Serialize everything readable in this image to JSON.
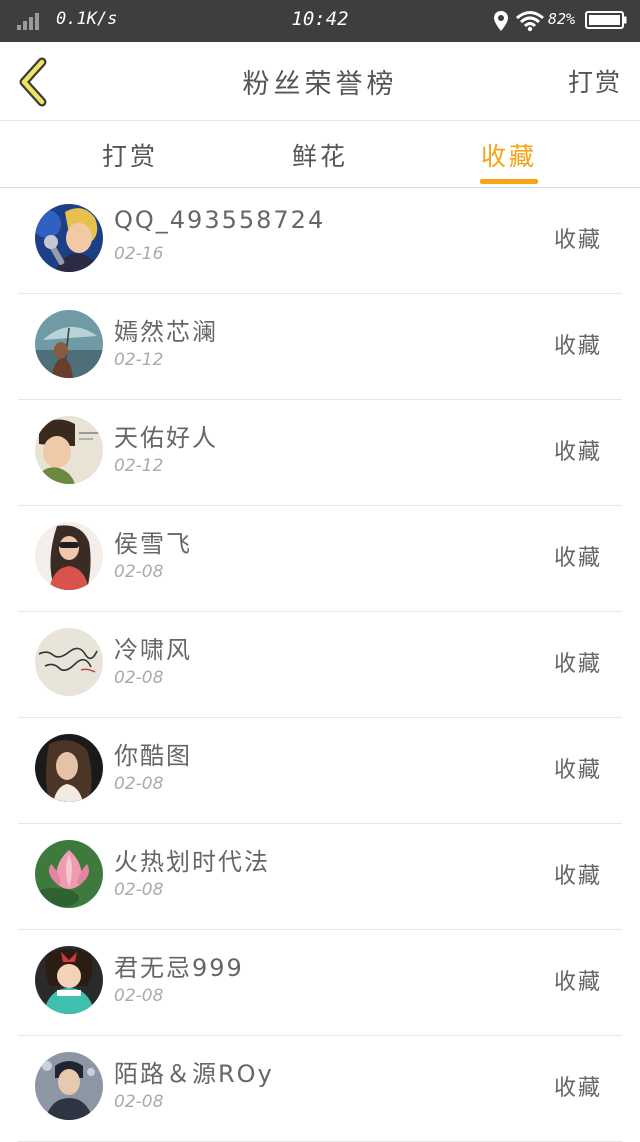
{
  "status_bar": {
    "speed": "0.1K/s",
    "time": "10:42",
    "battery": "82%"
  },
  "header": {
    "title": "粉丝荣誉榜",
    "action_label": "打赏"
  },
  "tabs": [
    {
      "label": "打赏",
      "active": false
    },
    {
      "label": "鲜花",
      "active": false
    },
    {
      "label": "收藏",
      "active": true
    }
  ],
  "accent_color": "#f5a417",
  "rows": [
    {
      "name": "QQ_493558724",
      "date": "02-16",
      "action": "收藏",
      "avatar": "avatar-singer-icon"
    },
    {
      "name": "嫣然芯澜",
      "date": "02-12",
      "action": "收藏",
      "avatar": "avatar-umbrella-girl-icon"
    },
    {
      "name": "天佑好人",
      "date": "02-12",
      "action": "收藏",
      "avatar": "avatar-boy-portrait-icon"
    },
    {
      "name": "侯雪飞",
      "date": "02-08",
      "action": "收藏",
      "avatar": "avatar-girl-sunglasses-icon"
    },
    {
      "name": "冷啸风",
      "date": "02-08",
      "action": "收藏",
      "avatar": "avatar-handwriting-icon"
    },
    {
      "name": "你酷图",
      "date": "02-08",
      "action": "收藏",
      "avatar": "avatar-woman-portrait-icon"
    },
    {
      "name": "火热划时代法",
      "date": "02-08",
      "action": "收藏",
      "avatar": "avatar-lotus-icon"
    },
    {
      "name": "君无忌999",
      "date": "02-08",
      "action": "收藏",
      "avatar": "avatar-cartoon-girl-icon"
    },
    {
      "name": "陌路＆源ROy",
      "date": "02-08",
      "action": "收藏",
      "avatar": "avatar-man-portrait-icon"
    }
  ]
}
